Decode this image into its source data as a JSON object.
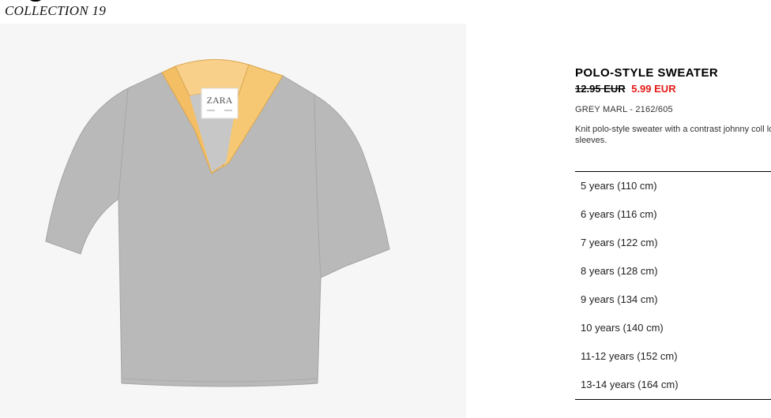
{
  "header": {
    "collection": "COLLECTION 19"
  },
  "product": {
    "title": "POLO-STYLE SWEATER",
    "old_price": "12.95 EUR",
    "new_price": "5.99 EUR",
    "color_ref": "GREY MARL - 2162/605",
    "description": "Knit polo-style sweater with a contrast johnny coll long sleeves.",
    "image_icon": "grey-sweater-yellow-collar-image",
    "label_brand": "ZARA",
    "colors": {
      "body": "#b4b4b4",
      "collar": "#f6c873",
      "sale": "#e41b17"
    }
  },
  "sizes": [
    "5 years (110 cm)",
    "6 years (116 cm)",
    "7 years (122 cm)",
    "8 years (128 cm)",
    "9 years (134 cm)",
    "10 years (140 cm)",
    "11-12 years (152 cm)",
    "13-14 years (164 cm)"
  ]
}
